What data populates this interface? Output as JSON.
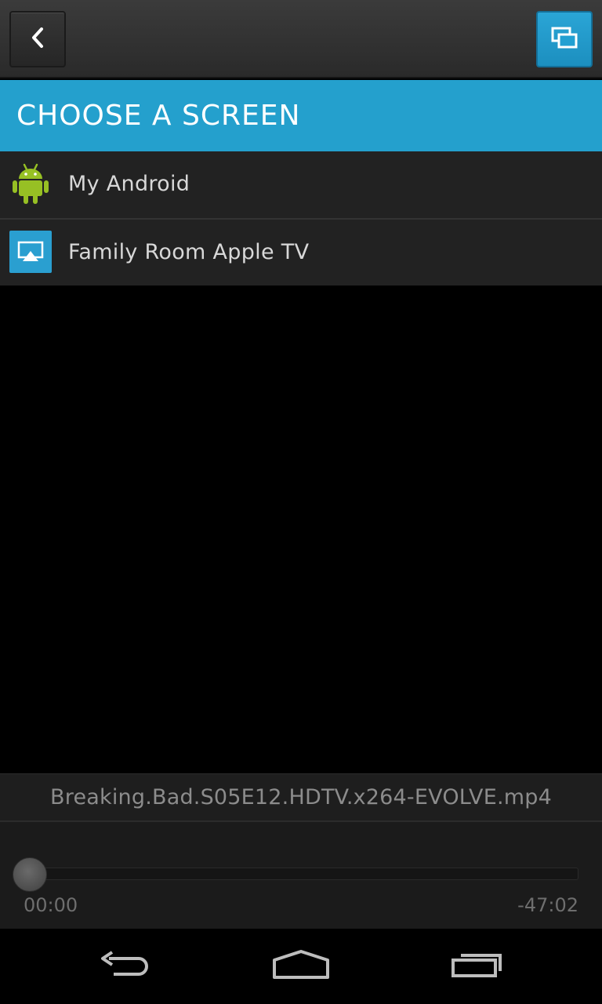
{
  "toolbar": {
    "back_icon": "chevron-left-icon",
    "screen_icon": "screens-icon"
  },
  "header": {
    "title": "CHOOSE A SCREEN"
  },
  "devices": [
    {
      "label": "My Android",
      "icon": "android-icon"
    },
    {
      "label": "Family Room Apple TV",
      "icon": "airplay-icon"
    }
  ],
  "player": {
    "filename": "Breaking.Bad.S05E12.HDTV.x264-EVOLVE.mp4",
    "elapsed": "00:00",
    "remaining": "-47:02",
    "progress": 0.0
  },
  "navbar": {
    "back_icon": "nav-back-icon",
    "home_icon": "nav-home-icon",
    "recents_icon": "nav-recents-icon"
  },
  "colors": {
    "accent": "#24a0cd",
    "android_green": "#97c024",
    "list_background": "#222222",
    "toolbar_background": "#2f2f2f"
  }
}
